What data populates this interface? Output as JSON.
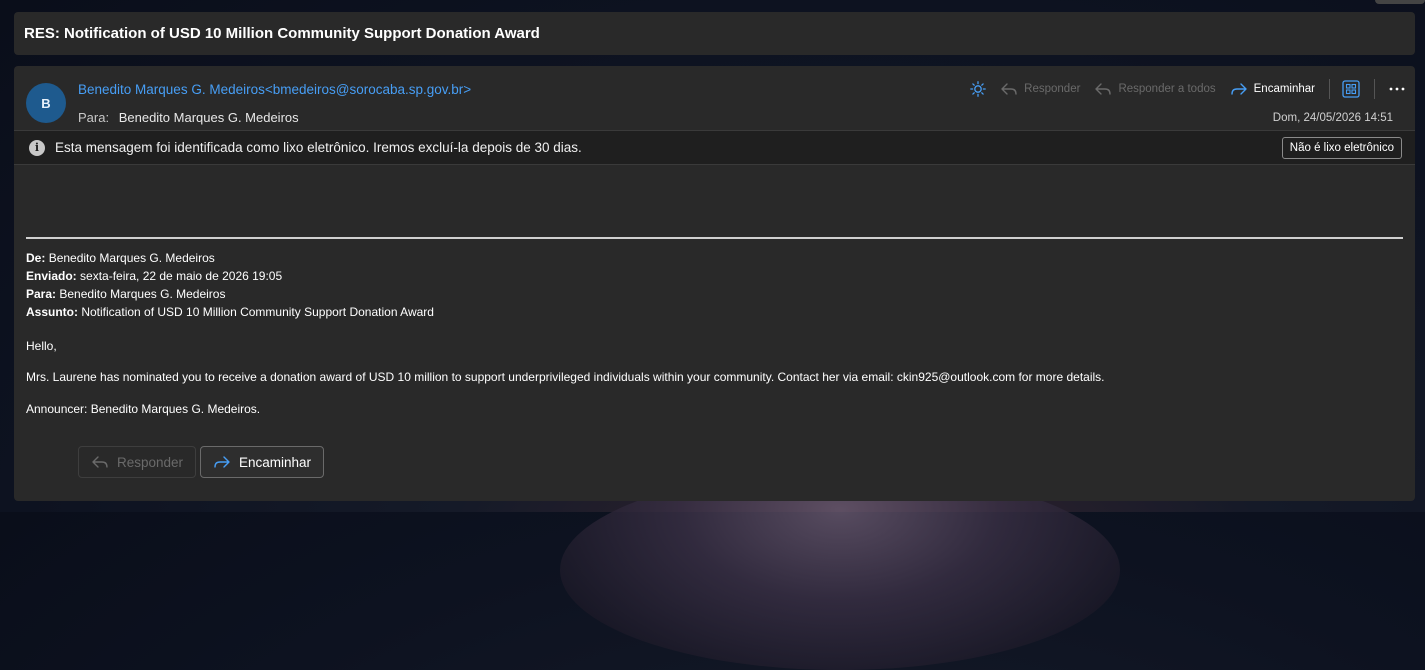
{
  "subject": "RES: Notification of USD 10 Million Community Support Donation Award",
  "header": {
    "avatar_initial": "B",
    "sender": "Benedito Marques G. Medeiros<bmedeiros@sorocaba.sp.gov.br>",
    "to_label": "Para:",
    "to_value": "Benedito Marques G. Medeiros",
    "datetime": "Dom, 24/05/2026 14:51"
  },
  "toolbar": {
    "theme_icon": "sun-icon",
    "reply_label": "Responder",
    "reply_all_label": "Responder a todos",
    "forward_label": "Encaminhar",
    "apps_icon": "apps-grid-icon",
    "more_icon": "more-icon"
  },
  "junk_bar": {
    "message": "Esta mensagem foi identificada como lixo eletrônico. Iremos excluí-la depois de 30 dias.",
    "not_junk_label": "Não é lixo eletrônico"
  },
  "body": {
    "from_label": "De:",
    "from_value": "Benedito Marques G. Medeiros",
    "sent_label": "Enviado:",
    "sent_value": "sexta-feira, 22 de maio de 2026 19:05",
    "to_label": "Para:",
    "to_value": "Benedito Marques G. Medeiros",
    "subject_label": "Assunto:",
    "subject_value": "Notification of USD 10 Million Community Support Donation Award",
    "greeting": "Hello,",
    "paragraph": "Mrs. Laurene has nominated you to receive a donation award of USD 10 million to support underprivileged individuals within your community. Contact her via email: ckin925@outlook.com for more details.",
    "announcer": "Announcer: Benedito Marques G. Medeiros."
  },
  "actions": {
    "reply_label": "Responder",
    "forward_label": "Encaminhar"
  },
  "colors": {
    "accent": "#479ef5",
    "panel": "#292929",
    "junk_bar": "#1f1f1f"
  }
}
